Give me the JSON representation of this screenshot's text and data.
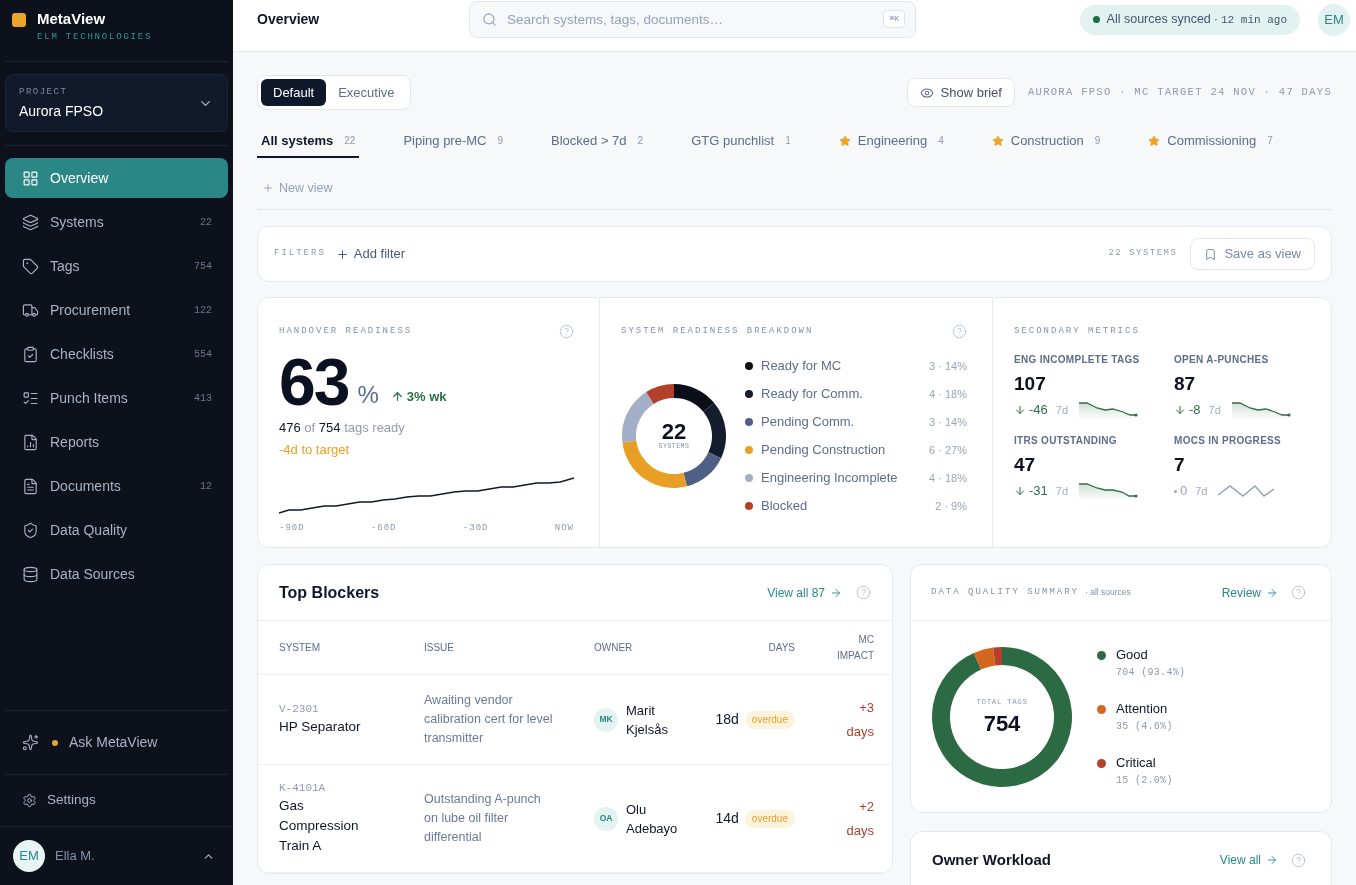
{
  "sidebar": {
    "brand": {
      "name": "MetaView",
      "company": "ELM TECHNOLOGIES"
    },
    "project": {
      "label": "PROJECT",
      "value": "Aurora FPSO"
    },
    "nav": [
      {
        "label": "Overview",
        "selected": true
      },
      {
        "label": "Systems",
        "count": "22",
        "selected": false
      },
      {
        "label": "Tags",
        "count": "754",
        "selected": false
      },
      {
        "label": "Procurement",
        "count": "122",
        "selected": false
      },
      {
        "label": "Checklists",
        "count": "554",
        "selected": false
      },
      {
        "label": "Punch Items",
        "count": "413",
        "selected": false
      },
      {
        "label": "Reports",
        "selected": false
      },
      {
        "label": "Documents",
        "count": "12",
        "selected": false
      },
      {
        "label": "Data Quality",
        "selected": false
      },
      {
        "label": "Data Sources",
        "selected": false
      }
    ],
    "assistant": {
      "label": "Ask MetaView",
      "unread": true
    },
    "settings": {
      "label": "Settings"
    },
    "user": {
      "initials": "EM",
      "name": "Ella M."
    }
  },
  "header": {
    "title": "Overview",
    "search": {
      "placeholder": "Search systems, tags, documents…",
      "shortcut": "⌘K"
    },
    "sync": {
      "label": "All sources synced",
      "separator": "·",
      "time": "12 min ago"
    },
    "avatar": {
      "initials": "EM"
    }
  },
  "layout_toggle": [
    {
      "label": "Default",
      "selected": true
    },
    {
      "label": "Executive",
      "selected": false
    }
  ],
  "brief_button": {
    "label": "Show brief"
  },
  "context": "AURORA FPSO · MC TARGET 24 NOV · 47 DAYS",
  "views": [
    {
      "label": "All systems",
      "count": "22",
      "starred": false,
      "selected": true
    },
    {
      "label": "Piping pre-MC",
      "count": "9",
      "starred": false,
      "selected": false
    },
    {
      "label": "Blocked > 7d",
      "count": "2",
      "starred": false,
      "selected": false
    },
    {
      "label": "GTG punchlist",
      "count": "1",
      "starred": false,
      "selected": false
    },
    {
      "label": "Engineering",
      "count": "4",
      "starred": true,
      "selected": false
    },
    {
      "label": "Construction",
      "count": "9",
      "starred": true,
      "selected": false
    },
    {
      "label": "Commissioning",
      "count": "7",
      "starred": true,
      "selected": false
    }
  ],
  "new_view": {
    "label": "New view"
  },
  "filters": {
    "label": "FILTERS",
    "add": "Add filter",
    "result_count": "22 SYSTEMS",
    "save": "Save as view"
  },
  "handover": {
    "title": "HANDOVER READINESS",
    "value": "63",
    "unit": "%",
    "change": {
      "rising": true,
      "label": "3% wk"
    },
    "tags_ready": [
      {
        "text": "476",
        "strong": true
      },
      {
        "text": "of",
        "strong": false
      },
      {
        "text": "754",
        "strong": true
      },
      {
        "text": "tags ready",
        "strong": false
      }
    ],
    "target": "-4d to target",
    "axis": [
      "-90D",
      "-60D",
      "-30D",
      "NOW"
    ]
  },
  "breakdown": {
    "title": "SYSTEM READINESS BREAKDOWN",
    "center_value": "22",
    "center_label": "SYSTEMS",
    "chart_data": {
      "type": "donut",
      "categories": [
        "Ready for MC",
        "Ready for Comm.",
        "Pending Comm.",
        "Pending Construction",
        "Engineering Incomplete",
        "Blocked"
      ],
      "values": [
        14,
        18,
        14,
        27,
        18,
        9
      ]
    },
    "legend": [
      {
        "color": "#0b0f19",
        "value": "3 · 14%"
      },
      {
        "color": "#141c2e",
        "value": "4 · 18%"
      },
      {
        "color": "#4f6086",
        "value": "3 · 14%"
      },
      {
        "color": "#e8a024",
        "value": "6 · 27%"
      },
      {
        "color": "#a2afc6",
        "value": "4 · 18%"
      },
      {
        "color": "#b3402a",
        "value": "2 · 9%"
      }
    ]
  },
  "secondary": {
    "title": "SECONDARY METRICS",
    "metrics": [
      {
        "kind": "down",
        "label": "ENG INCOMPLETE TAGS",
        "value": "107",
        "change": "-46",
        "period": "7d"
      },
      {
        "kind": "down",
        "label": "OPEN A-PUNCHES",
        "value": "87",
        "change": "-8",
        "period": "7d"
      },
      {
        "kind": "down",
        "label": "ITRS OUTSTANDING",
        "value": "47",
        "change": "-31",
        "period": "7d"
      },
      {
        "kind": "flat",
        "label": "MOCS IN PROGRESS",
        "value": "7",
        "change": "0",
        "period": "7d"
      }
    ]
  },
  "blockers": {
    "title": "Top Blockers",
    "link": "View all 87",
    "columns": [
      "SYSTEM",
      "ISSUE",
      "OWNER",
      "DAYS",
      "MC IMPACT"
    ],
    "rows": [
      {
        "code": "V-2301",
        "system": "HP Separator",
        "issue": "Awaiting vendor calibration cert for level transmitter",
        "owner": {
          "initials": "MK",
          "name": "Marit Kjelsås"
        },
        "days": "18d",
        "status": "overdue",
        "impact": "+3 days"
      },
      {
        "code": "K-4101A",
        "system": "Gas Compression Train A",
        "issue": "Outstanding A-punch on lube oil filter differential",
        "owner": {
          "initials": "OA",
          "name": "Olu Adebayo"
        },
        "days": "14d",
        "status": "overdue",
        "impact": "+2 days"
      }
    ]
  },
  "data_quality": {
    "title": "DATA QUALITY SUMMARY",
    "scope": "· all sources",
    "link": "Review",
    "center_label": "TOTAL TAGS",
    "center_value": "754",
    "chart_data": {
      "type": "donut",
      "categories": [
        "Good",
        "Attention",
        "Critical"
      ],
      "values": [
        93.4,
        4.6,
        2.0
      ]
    },
    "legend": [
      {
        "color": "#2b6a42",
        "detail": "704 (93.4%)"
      },
      {
        "color": "#d4661f",
        "detail": "35 (4.6%)"
      },
      {
        "color": "#b3402a",
        "detail": "15 (2.0%)"
      }
    ]
  },
  "owner_workload": {
    "title": "Owner Workload",
    "link": "View all"
  }
}
